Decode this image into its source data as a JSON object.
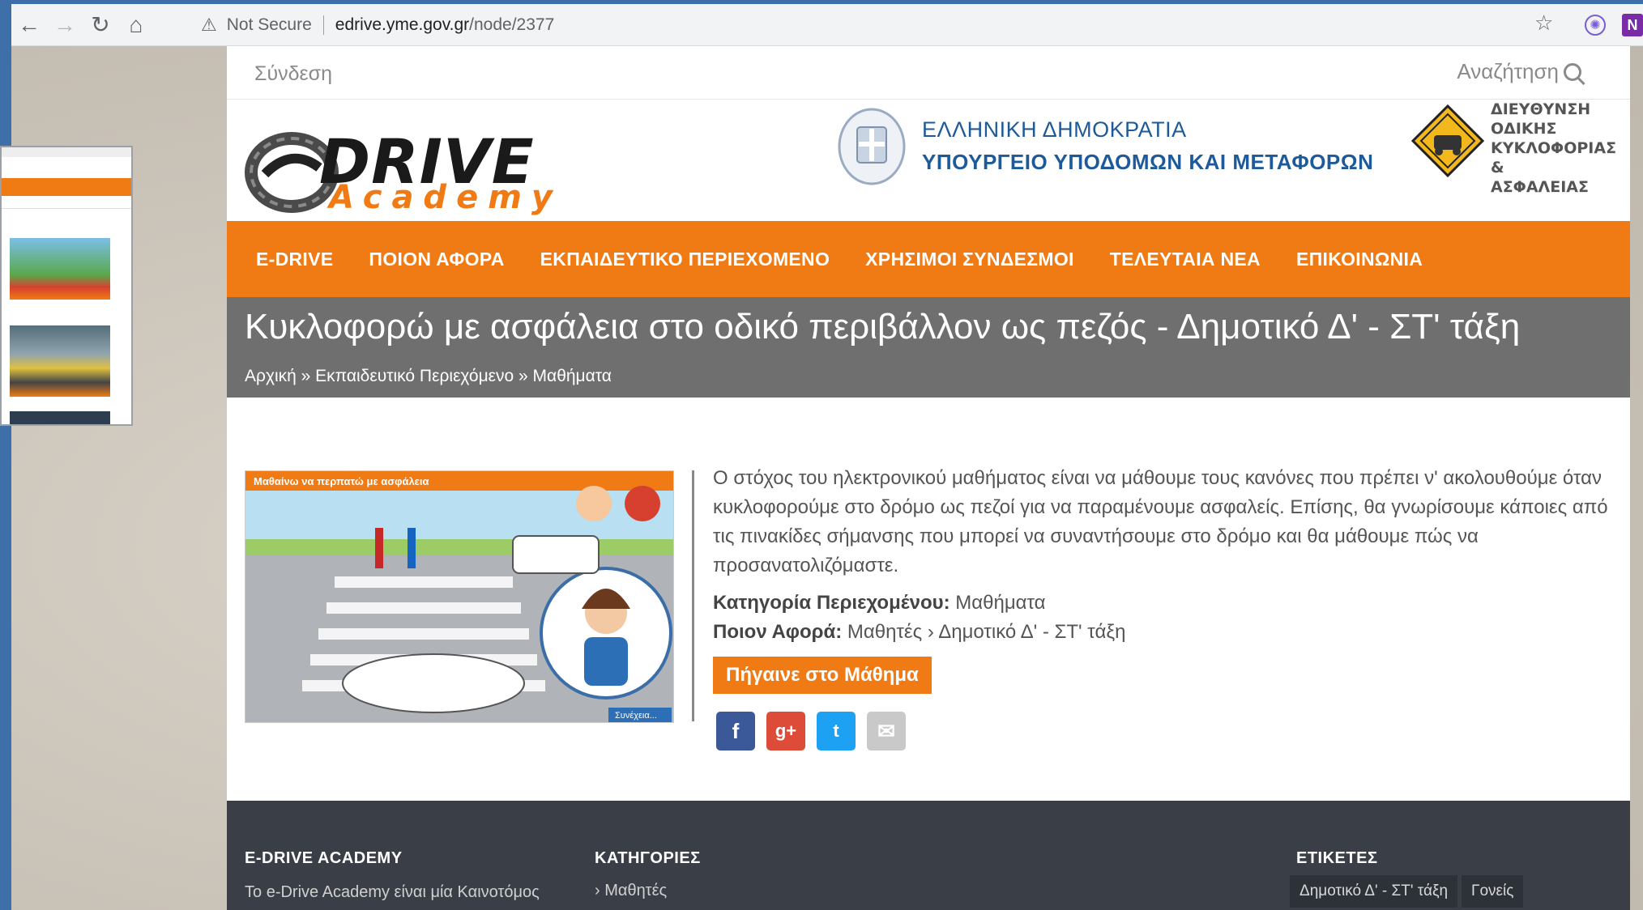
{
  "browser": {
    "security_label": "Not Secure",
    "url_host": "edrive.yme.gov.gr",
    "url_path": "/node/2377"
  },
  "topbar": {
    "login_label": "Σύνδεση",
    "search_label": "Αναζήτηση"
  },
  "header": {
    "logo_drive": "DRIVE",
    "logo_academy": "Academy",
    "gov_line1": "ΕΛΛΗΝΙΚΗ ΔΗΜΟΚΡΑΤΙΑ",
    "gov_line2": "ΥΠΟΥΡΓΕΙΟ ΥΠΟΔΟΜΩΝ ΚΑΙ ΜΕΤΑΦΟΡΩΝ",
    "directorate": [
      "ΔΙΕΥΘΥΝΣΗ",
      "ΟΔΙΚΗΣ",
      "ΚΥΚΛΟΦΟΡΙΑΣ &",
      "ΑΣΦΑΛΕΙΑΣ"
    ]
  },
  "nav": {
    "items": [
      "E-DRIVE",
      "ΠΟΙΟΝ ΑΦΟΡΑ",
      "ΕΚΠΑΙΔΕΥΤΙΚΟ ΠΕΡΙΕΧΟΜΕΝΟ",
      "ΧΡΗΣΙΜΟΙ ΣΥΝΔΕΣΜΟΙ",
      "ΤΕΛΕΥΤΑΙΑ ΝΕΑ",
      "ΕΠΙΚΟΙΝΩΝΙΑ"
    ]
  },
  "title": {
    "text": "Κυκλοφορώ με ασφάλεια στο οδικό περιβάλλον ως πεζός - Δημοτικό Δ' - ΣΤ' τάξη",
    "breadcrumb": "Αρχική » Εκπαιδευτικό Περιεχόμενο » Μαθήματα"
  },
  "lesson": {
    "image_caption": "Μαθαίνω να περπατώ με ασφάλεια",
    "image_continue": "Συνέχεια...",
    "description": "Ο στόχος του ηλεκτρονικού μαθήματος είναι να μάθουμε τους κανόνες που πρέπει ν' ακολουθούμε όταν κυκλοφορούμε στο δρόμο ως πεζοί για να παραμένουμε ασφαλείς. Επίσης, θα γνωρίσουμε κάποιες από τις πινακίδες σήμανσης που μπορεί να συναντήσουμε στο δρόμο και θα μάθουμε πώς να προσανατολιζόμαστε.",
    "category_key": "Κατηγορία Περιεχομένου:",
    "category_value": "Μαθήματα",
    "audience_key": "Ποιον Αφορά:",
    "audience_value": "Μαθητές  ›  Δημοτικό Δ' - ΣΤ' τάξη",
    "go_button": "Πήγαινε στο Μάθημα"
  },
  "share": {
    "facebook": "f",
    "google": "g+",
    "twitter": "t",
    "email": "✉"
  },
  "footer": {
    "col1_title": "E-DRIVE ACADEMY",
    "col1_text": "Το e-Drive Academy είναι μία Καινοτόμος",
    "col2_title": "ΚΑΤΗΓΟΡΙΕΣ",
    "col2_item": "›  Μαθητές",
    "col3_title": "ΕΤΙΚΕΤΕΣ",
    "tags": [
      "Δημοτικό Δ' - ΣΤ' τάξη",
      "Γονείς"
    ]
  },
  "colors": {
    "accent": "#f07b14",
    "title_bar": "#6f6f6f",
    "footer": "#3a3f47",
    "gov_blue": "#1e5a9a"
  }
}
